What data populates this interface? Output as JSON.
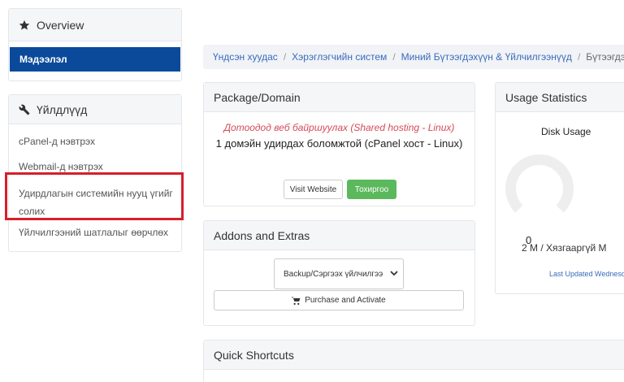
{
  "sidebar": {
    "overview": {
      "title": "Overview",
      "active_item": "Мэдээлэл"
    },
    "services": {
      "title": "Үйлдлүүд",
      "items": [
        "cPanel-д нэвтрэх",
        "Webmail-д нэвтрэх",
        "Удирдлагын системийн нууц үгийг солих",
        "Үйлчилгээний шатлалыг өөрчлөх"
      ]
    }
  },
  "breadcrumb": {
    "items": [
      "Үндсэн хуудас",
      "Хэрэглэгчийн систем",
      "Миний Бүтээгдэхүүн & Үйлчилгээнүүд"
    ],
    "current": "Бүтээгдэхүүн"
  },
  "package": {
    "title": "Package/Domain",
    "type": "Дотоодод веб байршуулах (Shared hosting - Linux)",
    "description": "1 домэйн удирдах боломжтой (cPanel хост - Linux)",
    "visit_button": "Visit Website",
    "settings_button": "Тохиргоо"
  },
  "addons": {
    "title": "Addons and Extras",
    "select_value": "Backup/Сэргээх үйлчилгээ",
    "purchase_button": "Purchase and Activate"
  },
  "usage": {
    "title": "Usage Statistics",
    "disk_title": "Disk Usage",
    "gauge_value": "0",
    "gauge_percent": 0,
    "gauge_text": "2 M / Хязгааргүй M",
    "last_updated": "Last Updated Wednesd"
  },
  "quick": {
    "title": "Quick Shortcuts"
  },
  "colors": {
    "active_bg": "#0b4a9a",
    "highlight": "#d5202a",
    "success": "#5cb85c",
    "link": "#3a6bbd",
    "italic_red": "#d64a57"
  },
  "icons": [
    "star-icon",
    "wrench-icon",
    "chevron-down-icon",
    "cart-icon"
  ]
}
